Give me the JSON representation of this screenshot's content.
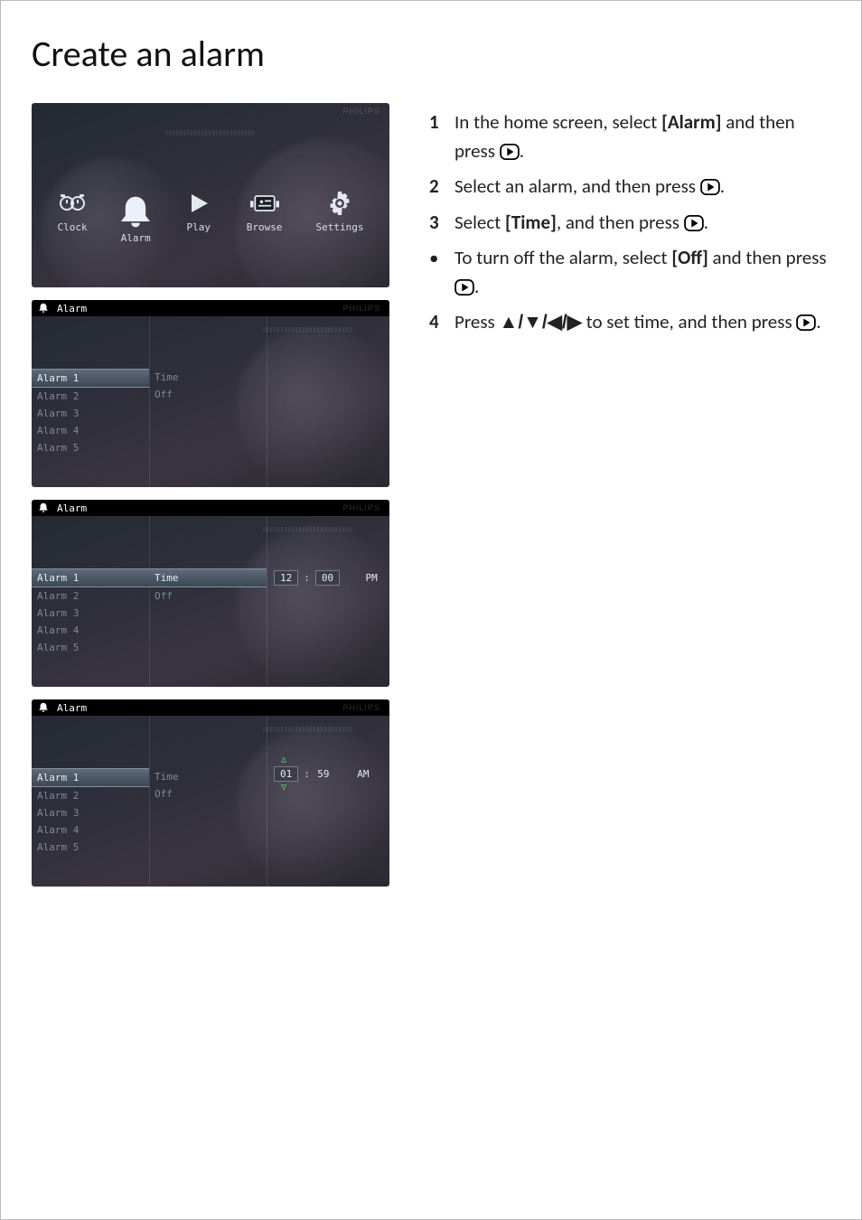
{
  "title": "Create an alarm",
  "brand": "PHILIPS",
  "home_items": [
    {
      "id": "clock",
      "label": "Clock"
    },
    {
      "id": "alarm",
      "label": "Alarm",
      "selected": true
    },
    {
      "id": "play",
      "label": "Play"
    },
    {
      "id": "browse",
      "label": "Browse"
    },
    {
      "id": "settings",
      "label": "Settings"
    }
  ],
  "alarm_header_label": "Alarm",
  "alarm_list": [
    "Alarm 1",
    "Alarm 2",
    "Alarm 3",
    "Alarm 4",
    "Alarm 5"
  ],
  "time_options": {
    "time": "Time",
    "off": "Off"
  },
  "screen2_value": {
    "hh": "12",
    "sep": ":",
    "mm": "00",
    "ampm": "PM"
  },
  "screen3_value": {
    "hh": "01",
    "sep": ":",
    "mm": "59",
    "ampm": "AM"
  },
  "steps": {
    "s1a": "In the home screen, select ",
    "s1b": "[Alarm]",
    "s1c": " and then press ",
    "s2a": "Select an alarm, and then press ",
    "s3a": "Select ",
    "s3b": "[Time]",
    "s3c": ", and then press ",
    "bulleta": "To turn off the alarm, select ",
    "bulletb": "[Off]",
    "bulletc": " and then press ",
    "s4a": "Press ",
    "s4b": " to set time, and then press ",
    "period": "."
  },
  "arrows": "▲/▼/◀/▶"
}
